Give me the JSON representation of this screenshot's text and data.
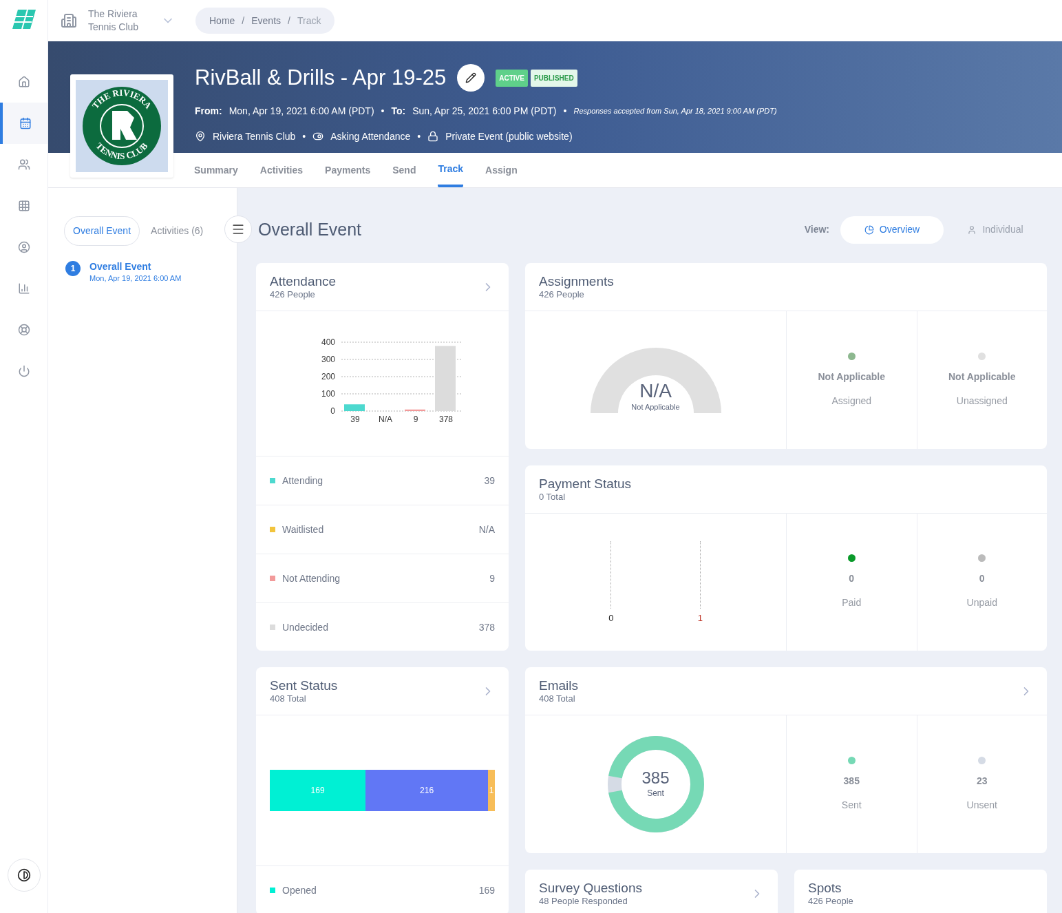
{
  "top_bar": {
    "organization": "The Riviera Tennis Club",
    "breadcrumbs": [
      "Home",
      "Events",
      "Track"
    ],
    "breadcrumb_separator": "/"
  },
  "nav": [
    {
      "kind": "home",
      "selected": false
    },
    {
      "kind": "calendar",
      "selected": true
    },
    {
      "kind": "users",
      "selected": false
    },
    {
      "kind": "apps",
      "selected": false
    },
    {
      "kind": "account",
      "selected": false
    },
    {
      "kind": "reports",
      "selected": false
    },
    {
      "kind": "support",
      "selected": false
    },
    {
      "kind": "power",
      "selected": false
    }
  ],
  "event": {
    "separator": "•",
    "logo_top": "THE RIVIERA",
    "logo_bottom": "TENNIS CLUB",
    "title": "RivBall & Drills - Apr 19-25",
    "badges": [
      {
        "label": "ACTIVE",
        "kind": "solid"
      },
      {
        "label": "PUBLISHED",
        "kind": "light"
      }
    ],
    "from_label": "From:",
    "from": "Mon, Apr 19, 2021 6:00 AM (PDT)",
    "to_label": "To:",
    "to": "Sun, Apr 25, 2021 6:00 PM (PDT)",
    "responses": "Responses accepted from Sun, Apr 18, 2021 9:00 AM (PDT)",
    "details": [
      {
        "kind": "location",
        "text": "Riviera Tennis Club"
      },
      {
        "kind": "attendance",
        "text": "Asking Attendance"
      },
      {
        "kind": "privacy",
        "text": "Private Event (public website)"
      }
    ]
  },
  "tabs": [
    {
      "label": "Summary",
      "selected": false
    },
    {
      "label": "Activities",
      "selected": false
    },
    {
      "label": "Payments",
      "selected": false
    },
    {
      "label": "Send",
      "selected": false
    },
    {
      "label": "Track",
      "selected": true
    },
    {
      "label": "Assign",
      "selected": false
    }
  ],
  "side_panel": {
    "tabs": [
      {
        "label": "Overall Event",
        "selected": true
      },
      {
        "label": "Activities (6)",
        "selected": false
      }
    ],
    "items": [
      {
        "number": "1",
        "title": "Overall Event",
        "date": "Mon, Apr 19, 2021 6:00 AM",
        "selected": true
      }
    ]
  },
  "main": {
    "title": "Overall Event",
    "view_label": "View:",
    "views": [
      {
        "label": "Overview",
        "kind": "overview",
        "selected": true
      },
      {
        "label": "Individual",
        "kind": "individual",
        "selected": false
      }
    ]
  },
  "attendance": {
    "title": "Attendance",
    "subtitle": "426 People",
    "arrow": true,
    "chart_data": {
      "type": "bar",
      "categories": [
        "39",
        "N/A",
        "9",
        "378"
      ],
      "values": [
        39,
        null,
        9,
        378
      ],
      "ylim": [
        0,
        400
      ],
      "grid": true,
      "yticks": [
        0,
        100,
        200,
        300,
        400
      ]
    },
    "rows": [
      {
        "label": "Attending",
        "value": "39",
        "color": "#4dd9cf"
      },
      {
        "label": "Waitlisted",
        "value": "N/A",
        "color": "#f2c43d"
      },
      {
        "label": "Not Attending",
        "value": "9",
        "color": "#f29a9a"
      },
      {
        "label": "Undecided",
        "value": "378",
        "color": "#dcdcdc"
      }
    ]
  },
  "assignments": {
    "title": "Assignments",
    "subtitle": "426 People",
    "gauge_value": "N/A",
    "gauge_label": "Not Applicable",
    "stats": [
      {
        "value": "Not Applicable",
        "label": "Assigned",
        "color": "#8db88f"
      },
      {
        "value": "Not Applicable",
        "label": "Unassigned",
        "color": "#e0e0e0"
      }
    ]
  },
  "payment": {
    "title": "Payment Status",
    "subtitle": "0 Total",
    "axis_labels": [
      {
        "text": "0",
        "color": "#222222"
      },
      {
        "text": "1",
        "color": "#c0392b"
      }
    ],
    "stats": [
      {
        "value": "0",
        "label": "Paid",
        "color": "#0a9a2a"
      },
      {
        "value": "0",
        "label": "Unpaid",
        "color": "#bbbbbb"
      }
    ]
  },
  "sent_status": {
    "title": "Sent Status",
    "subtitle": "408 Total",
    "arrow": true,
    "chart_data": {
      "type": "bar",
      "orientation": "horizontal",
      "stacked": true,
      "data_labels": true,
      "series": [
        {
          "color": "#00f0d4",
          "values": [
            169
          ]
        },
        {
          "color": "#6177f5",
          "values": [
            216
          ]
        },
        {
          "color": "#f7bd58",
          "values": [
            1
          ]
        }
      ]
    },
    "rows": [
      {
        "label": "Opened",
        "value": "169",
        "color": "#00f0d4"
      }
    ]
  },
  "emails": {
    "title": "Emails",
    "subtitle": "408 Total",
    "arrow": true,
    "center_value": "385",
    "center_label": "Sent",
    "ring": {
      "level": 0.944
    },
    "stats": [
      {
        "value": "385",
        "label": "Sent",
        "color": "#76d9b5"
      },
      {
        "value": "23",
        "label": "Unsent",
        "color": "#d5dbe5"
      }
    ]
  },
  "survey": {
    "title": "Survey Questions",
    "subtitle": "48 People Responded",
    "arrow": true
  },
  "spots": {
    "title": "Spots",
    "subtitle": "426 People"
  }
}
